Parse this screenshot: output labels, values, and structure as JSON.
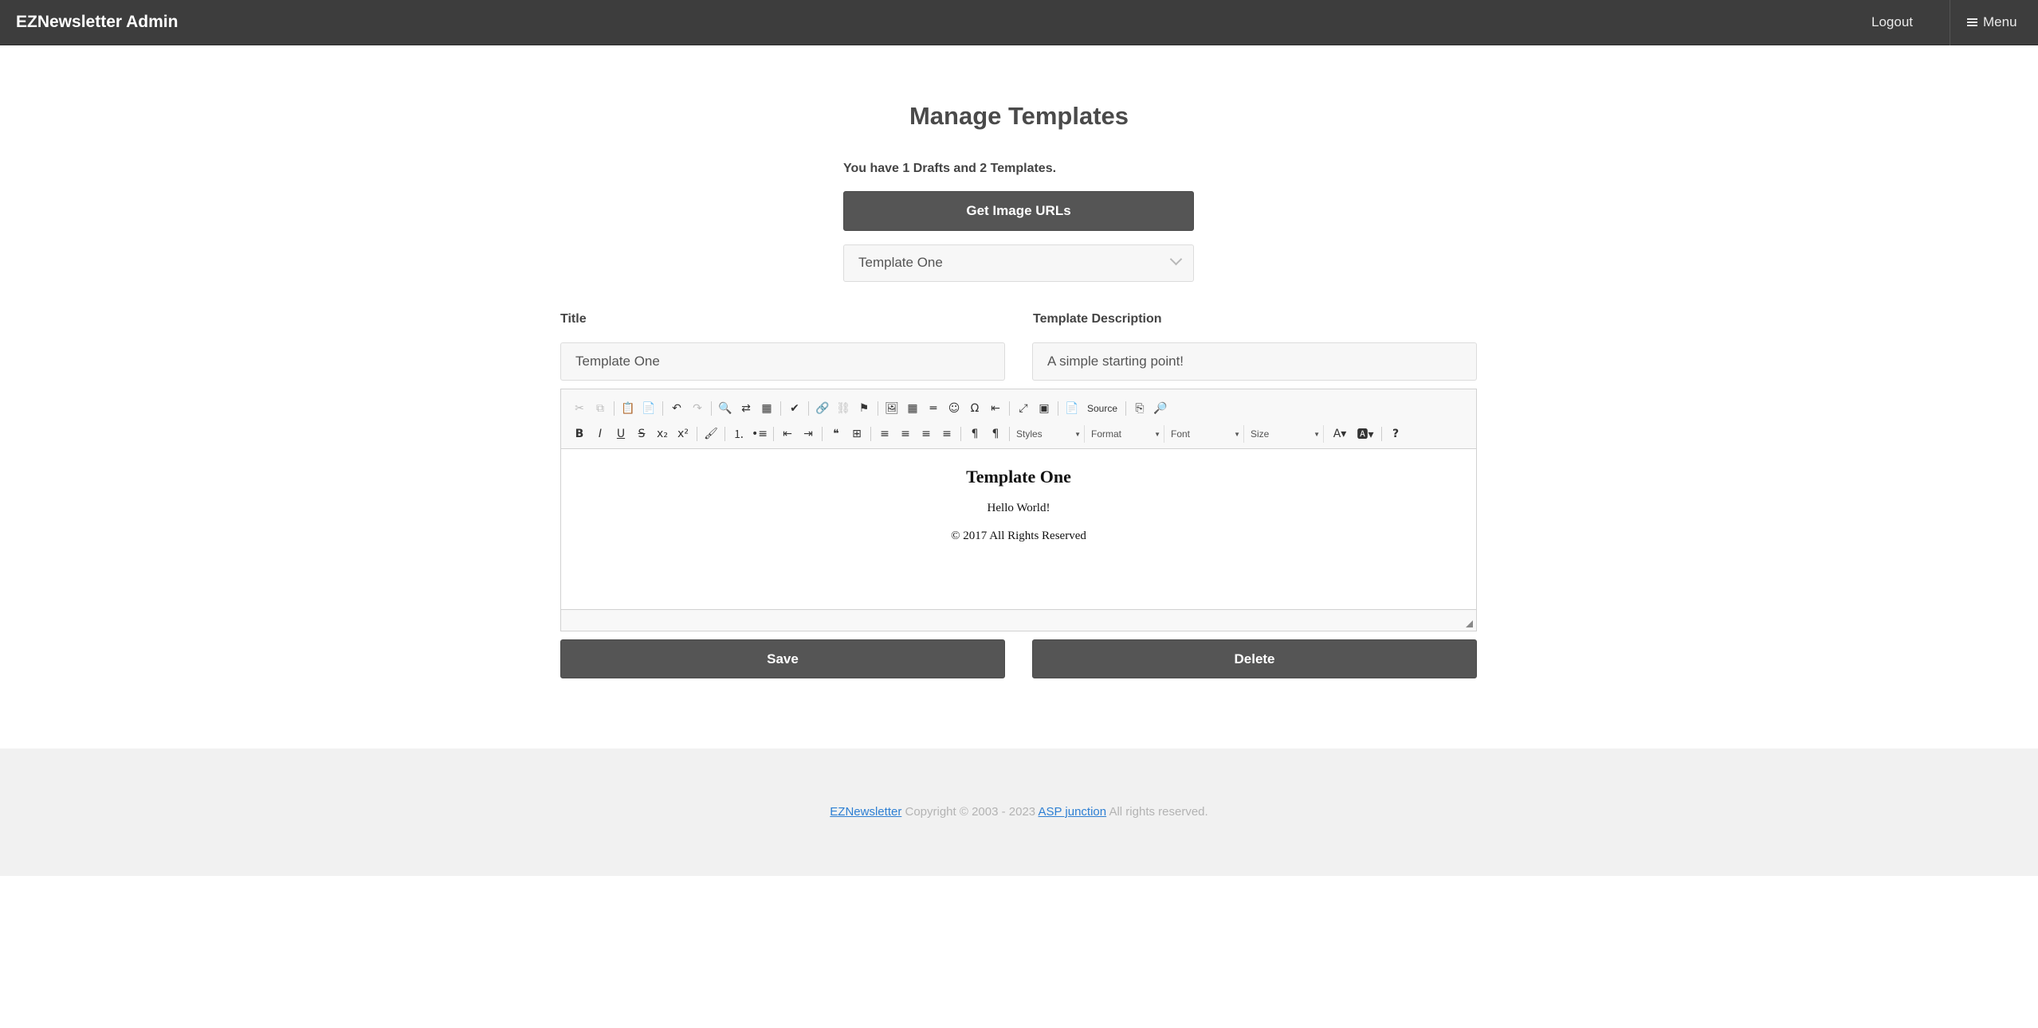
{
  "navbar": {
    "brand": "EZNewsletter Admin",
    "logout": "Logout",
    "menu": "Menu"
  },
  "main": {
    "title": "Manage Templates",
    "count_text": "You have 1 Drafts and 2 Templates.",
    "get_images_label": "Get Image URLs",
    "template_select": {
      "selected": "Template One"
    },
    "title_label": "Title",
    "title_value": "Template One",
    "description_label": "Template Description",
    "description_value": "A simple starting point!",
    "save_label": "Save",
    "delete_label": "Delete"
  },
  "editor": {
    "toolbar_row1": [
      {
        "name": "cut-icon",
        "glyph": "✂",
        "enabled": false
      },
      {
        "name": "copy-icon",
        "glyph": "⧉",
        "enabled": false
      },
      {
        "name": "paste-icon",
        "glyph": "📋",
        "enabled": true
      },
      {
        "name": "paste-text-icon",
        "glyph": "📄",
        "enabled": true
      },
      {
        "name": "undo-icon",
        "glyph": "↶",
        "enabled": true
      },
      {
        "name": "redo-icon",
        "glyph": "↷",
        "enabled": false
      },
      {
        "name": "find-icon",
        "glyph": "🔍",
        "enabled": true
      },
      {
        "name": "replace-icon",
        "glyph": "⇄",
        "enabled": true
      },
      {
        "name": "select-all-icon",
        "glyph": "▦",
        "enabled": true
      },
      {
        "name": "spellcheck-icon",
        "glyph": "✔",
        "enabled": true
      },
      {
        "name": "link-icon",
        "glyph": "🔗",
        "enabled": true
      },
      {
        "name": "unlink-icon",
        "glyph": "⛓",
        "enabled": false
      },
      {
        "name": "anchor-icon",
        "glyph": "⚑",
        "enabled": true
      },
      {
        "name": "image-icon",
        "glyph": "🖼",
        "enabled": true
      },
      {
        "name": "table-icon",
        "glyph": "▦",
        "enabled": true
      },
      {
        "name": "horizontal-line-icon",
        "glyph": "═",
        "enabled": true
      },
      {
        "name": "smiley-icon",
        "glyph": "☺",
        "enabled": true
      },
      {
        "name": "special-char-icon",
        "glyph": "Ω",
        "enabled": true
      },
      {
        "name": "page-break-icon",
        "glyph": "⇤",
        "enabled": true
      },
      {
        "name": "maximize-icon",
        "glyph": "⤢",
        "enabled": true
      },
      {
        "name": "show-blocks-icon",
        "glyph": "▣",
        "enabled": true
      },
      {
        "name": "source-icon",
        "glyph": "📄",
        "enabled": true
      },
      {
        "name": "templates-icon",
        "glyph": "⎘",
        "enabled": true
      },
      {
        "name": "preview-icon",
        "glyph": "🔎",
        "enabled": true
      }
    ],
    "source_label": "Source",
    "toolbar_row2": [
      {
        "name": "bold-icon",
        "glyph": "B"
      },
      {
        "name": "italic-icon",
        "glyph": "I"
      },
      {
        "name": "underline-icon",
        "glyph": "U"
      },
      {
        "name": "strikethrough-icon",
        "glyph": "S"
      },
      {
        "name": "subscript-icon",
        "glyph": "x₂"
      },
      {
        "name": "superscript-icon",
        "glyph": "x²"
      },
      {
        "name": "remove-format-icon",
        "glyph": "🖌"
      },
      {
        "name": "numbered-list-icon",
        "glyph": "⒈"
      },
      {
        "name": "bulleted-list-icon",
        "glyph": "•≡"
      },
      {
        "name": "outdent-icon",
        "glyph": "⇤"
      },
      {
        "name": "indent-icon",
        "glyph": "⇥"
      },
      {
        "name": "blockquote-icon",
        "glyph": "❝"
      },
      {
        "name": "div-container-icon",
        "glyph": "⊞"
      },
      {
        "name": "align-left-icon",
        "glyph": "≡"
      },
      {
        "name": "align-center-icon",
        "glyph": "≡"
      },
      {
        "name": "align-right-icon",
        "glyph": "≡"
      },
      {
        "name": "justify-icon",
        "glyph": "≡"
      },
      {
        "name": "ltr-icon",
        "glyph": "¶"
      },
      {
        "name": "rtl-icon",
        "glyph": "¶"
      }
    ],
    "combos": {
      "styles": "Styles",
      "format": "Format",
      "font": "Font",
      "size": "Size"
    },
    "help_glyph": "?",
    "content": {
      "heading": "Template One",
      "body": "Hello World!",
      "copyright": "© 2017 All Rights Reserved"
    }
  },
  "footer": {
    "brand_link": "EZNewsletter",
    "copyright": "Copyright © 2003 - 2023",
    "company_link": "ASP junction",
    "rights": "All rights reserved."
  }
}
